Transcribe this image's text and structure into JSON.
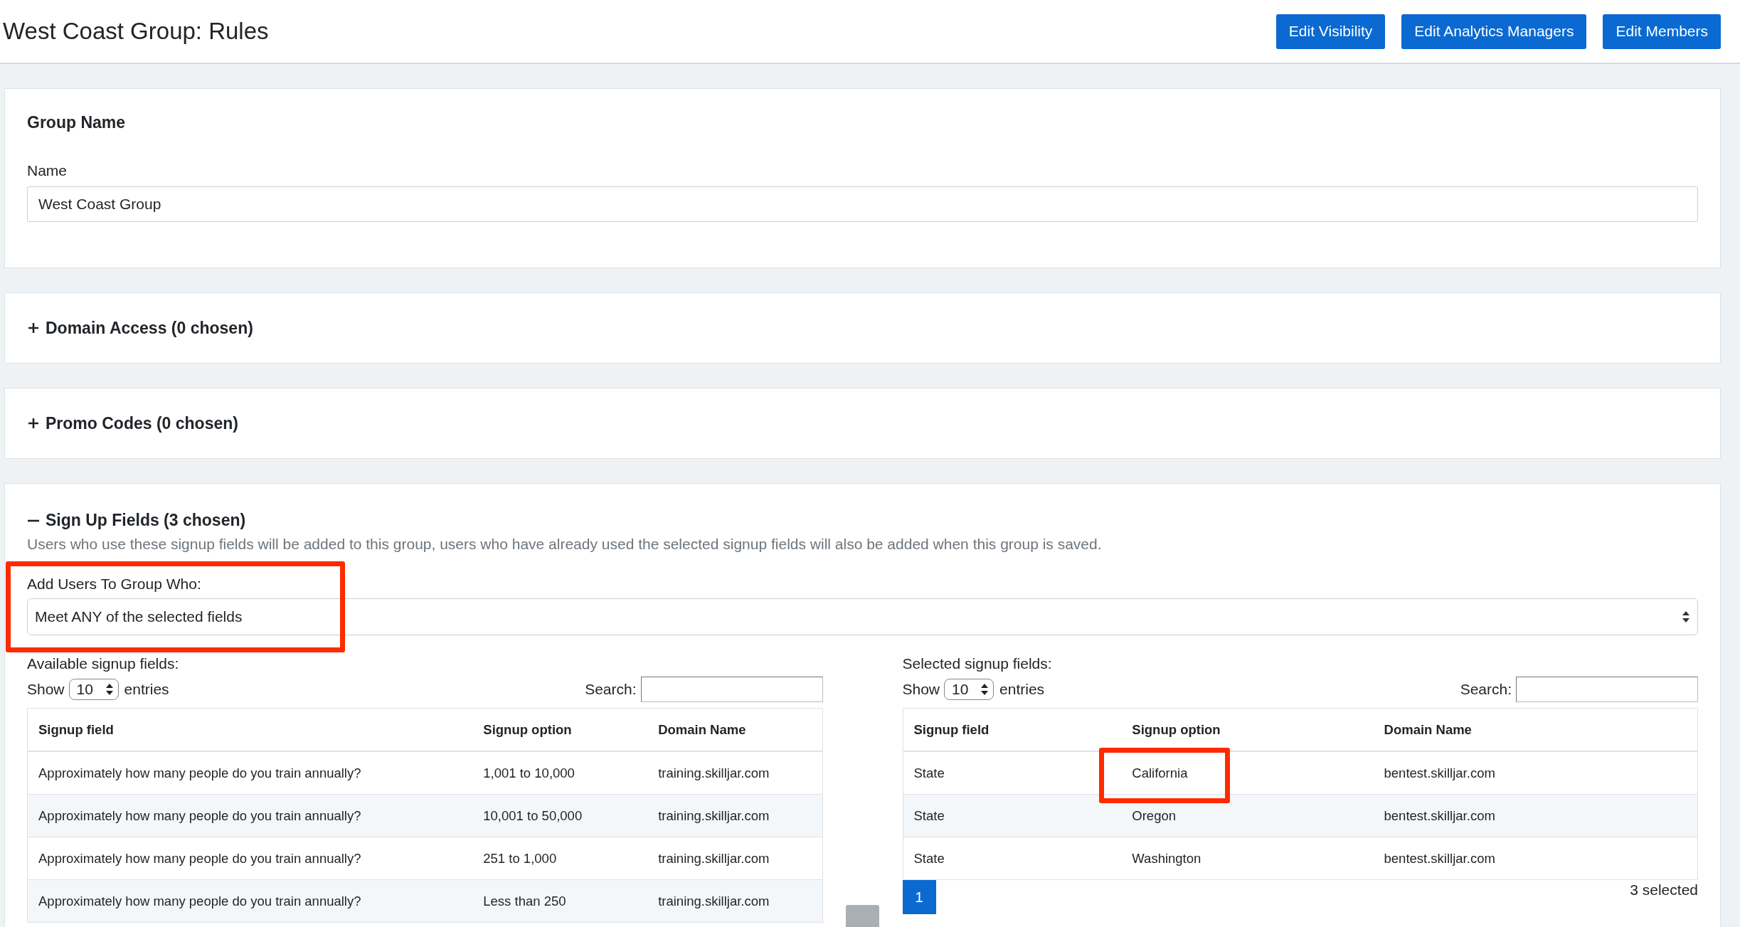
{
  "header": {
    "title": "West Coast Group: Rules",
    "buttons": [
      "Edit Visibility",
      "Edit Analytics Managers",
      "Edit Members"
    ]
  },
  "group_name": {
    "heading": "Group Name",
    "label": "Name",
    "value": "West Coast Group"
  },
  "sections": [
    {
      "title": "Domain Access (0 chosen)",
      "expanded": false
    },
    {
      "title": "Promo Codes (0 chosen)",
      "expanded": false
    }
  ],
  "signup": {
    "title": "Sign Up Fields (3 chosen)",
    "expanded": true,
    "description": "Users who use these signup fields will be added to this group, users who have already used the selected signup fields will also be added when this group is saved.",
    "rule_label": "Add Users To Group Who:",
    "rule_value": "Meet ANY of the selected fields",
    "rule_highlighted": true,
    "tables": [
      {
        "label": "Available signup fields:",
        "show": "Show",
        "entries_value": "10",
        "entries": "entries",
        "search_label": "Search:",
        "columns": [
          "Signup field",
          "Signup option",
          "Domain Name"
        ],
        "rows": [
          {
            "cells": [
              {
                "text": "Approximately how many people do you train annually?",
                "highlighted": false
              },
              {
                "text": "1,001 to 10,000",
                "highlighted": false
              },
              {
                "text": "training.skilljar.com",
                "highlighted": false
              }
            ]
          },
          {
            "cells": [
              {
                "text": "Approximately how many people do you train annually?",
                "highlighted": false
              },
              {
                "text": "10,001 to 50,000",
                "highlighted": false
              },
              {
                "text": "training.skilljar.com",
                "highlighted": false
              }
            ]
          },
          {
            "cells": [
              {
                "text": "Approximately how many people do you train annually?",
                "highlighted": false
              },
              {
                "text": "251 to 1,000",
                "highlighted": false
              },
              {
                "text": "training.skilljar.com",
                "highlighted": false
              }
            ]
          },
          {
            "cells": [
              {
                "text": "Approximately how many people do you train annually?",
                "highlighted": false
              },
              {
                "text": "Less than 250",
                "highlighted": false
              },
              {
                "text": "training.skilljar.com",
                "highlighted": false
              }
            ]
          }
        ]
      },
      {
        "label": "Selected signup fields:",
        "show": "Show",
        "entries_value": "10",
        "entries": "entries",
        "search_label": "Search:",
        "columns": [
          "Signup field",
          "Signup option",
          "Domain Name"
        ],
        "rows": [
          {
            "cells": [
              {
                "text": "State",
                "highlighted": false
              },
              {
                "text": "California",
                "highlighted": true
              },
              {
                "text": "bentest.skilljar.com",
                "highlighted": false
              }
            ]
          },
          {
            "cells": [
              {
                "text": "State",
                "highlighted": false
              },
              {
                "text": "Oregon",
                "highlighted": false
              },
              {
                "text": "bentest.skilljar.com",
                "highlighted": false
              }
            ]
          },
          {
            "cells": [
              {
                "text": "State",
                "highlighted": false
              },
              {
                "text": "Washington",
                "highlighted": false
              },
              {
                "text": "bentest.skilljar.com",
                "highlighted": false
              }
            ]
          }
        ],
        "pages": [
          {
            "label": "1",
            "selected": true
          }
        ],
        "count": "3 selected"
      }
    ]
  }
}
